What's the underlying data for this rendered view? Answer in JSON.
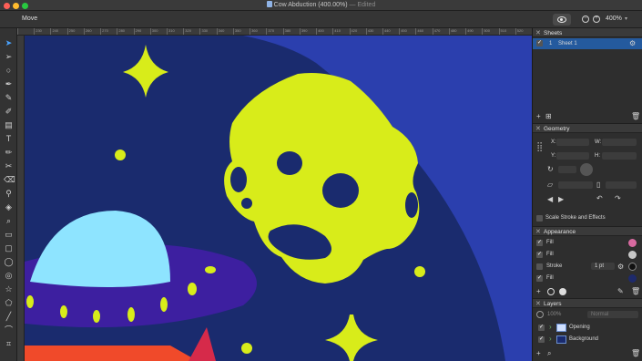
{
  "window": {
    "title": "Cow Abduction (400.00%)",
    "edited": "— Edited"
  },
  "toolbar": {
    "current_tool": "Move",
    "zoom": "400%"
  },
  "rulers": {
    "top_marks": [
      "",
      "230",
      "240",
      "250",
      "260",
      "270",
      "280",
      "290",
      "300",
      "310",
      "320",
      "330",
      "340",
      "350",
      "360",
      "370",
      "380",
      "390",
      "400",
      "410",
      "420",
      "430",
      "440",
      "450",
      "460",
      "470",
      "480",
      "490",
      "500",
      "510",
      "520"
    ]
  },
  "sheets": {
    "header": "Sheets",
    "items": [
      {
        "number": "1",
        "name": "Sheet 1"
      }
    ]
  },
  "geometry": {
    "header": "Geometry",
    "x_label": "X:",
    "y_label": "Y:",
    "w_label": "W:",
    "h_label": "H:",
    "scale_label": "Scale Stroke and Effects"
  },
  "appearance": {
    "header": "Appearance",
    "rows": [
      {
        "label": "Fill"
      },
      {
        "label": "Fill"
      },
      {
        "label": "Stroke",
        "value": "1 pt"
      },
      {
        "label": "Fill"
      }
    ],
    "colors": {
      "fill1": "#d86aa0",
      "fill2": "#c8c8c8",
      "stroke": "#111111",
      "fill3": "#1e2a6b"
    }
  },
  "layers": {
    "header": "Layers",
    "opacity": "100%",
    "blend": "Normal",
    "items": [
      {
        "name": "Opening"
      },
      {
        "name": "Background"
      }
    ]
  },
  "scene_colors": {
    "space": "#1a2b6e",
    "planet": "#2b3fae",
    "accent": "#d8ec1a",
    "ufo_dome": "#8ee4ff",
    "ufo_body": "#3d1fa0",
    "beam": "#f04a2a"
  }
}
